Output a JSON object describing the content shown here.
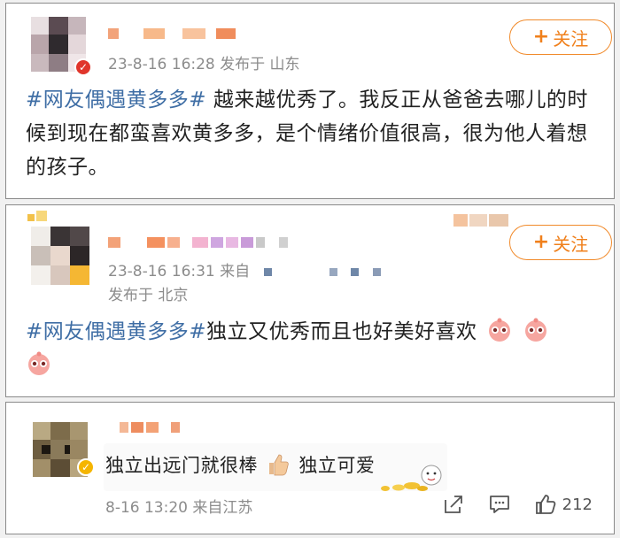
{
  "colors": {
    "hashtag": "#3f6ea5",
    "follow": "#f0801c",
    "meta": "#8c8c8c"
  },
  "post1": {
    "meta_line": "23-8-16 16:28 发布于 山东",
    "follow_label": "关注",
    "hashtag": "#网友偶遇黄多多#",
    "text": " 越来越优秀了。我反正从爸爸去哪儿的时候到现在都蛮喜欢黄多多，是个情绪价值很高，很为他人着想的孩子。"
  },
  "post2": {
    "meta_line1": "23-8-16 16:31 来自",
    "meta_line2": "发布于 北京",
    "follow_label": "关注",
    "hashtag": "#网友偶遇黄多多#",
    "text": "独立又优秀而且也好美好喜欢",
    "emoji_name": "pink-blush-emoji"
  },
  "post3": {
    "text_a": "独立出远门就很棒",
    "thumb_emoji": "thumbs-up-icon",
    "text_b": "独立可爱",
    "meta_line": "8-16 13:20 来自江苏",
    "like_count": "212",
    "icons": [
      "share-icon",
      "comment-icon",
      "like-icon"
    ]
  }
}
